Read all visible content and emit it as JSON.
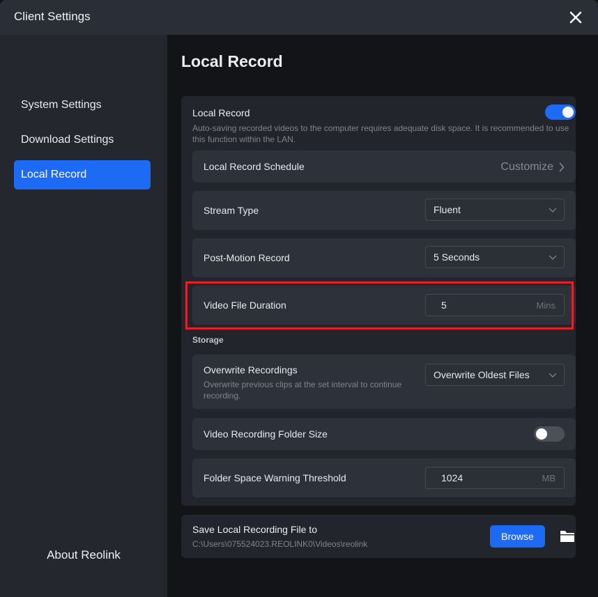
{
  "window": {
    "title": "Client Settings"
  },
  "sidebar": {
    "items": [
      {
        "label": "System Settings",
        "active": false
      },
      {
        "label": "Download Settings",
        "active": false
      },
      {
        "label": "Local Record",
        "active": true
      }
    ],
    "about": "About Reolink"
  },
  "main": {
    "title": "Local Record",
    "local_record": {
      "label": "Local Record",
      "enabled": true,
      "description": "Auto-saving recorded videos to the computer requires adequate disk space. It is recommended to use this function within the LAN."
    },
    "schedule": {
      "label": "Local Record Schedule",
      "action": "Customize"
    },
    "stream_type": {
      "label": "Stream Type",
      "value": "Fluent"
    },
    "post_motion": {
      "label": "Post-Motion Record",
      "value": "5 Seconds"
    },
    "file_duration": {
      "label": "Video File Duration",
      "value": "5",
      "unit": "Mins"
    },
    "storage_label": "Storage",
    "overwrite": {
      "label": "Overwrite Recordings",
      "description": "Overwrite previous clips at the set interval to continue recording.",
      "value": "Overwrite Oldest Files"
    },
    "folder_size": {
      "label": "Video Recording Folder Size",
      "enabled": false
    },
    "warning_threshold": {
      "label": "Folder Space Warning Threshold",
      "value": "1024",
      "unit": "MB"
    },
    "save_location": {
      "label": "Save Local Recording File to",
      "path": "C:\\Users\\075524023.REOLINK0\\Videos\\reolink",
      "browse_label": "Browse"
    }
  },
  "colors": {
    "accent": "#1d6af5",
    "highlight_border": "#e0222a",
    "panel": "#22252c",
    "row": "#2d3139"
  }
}
